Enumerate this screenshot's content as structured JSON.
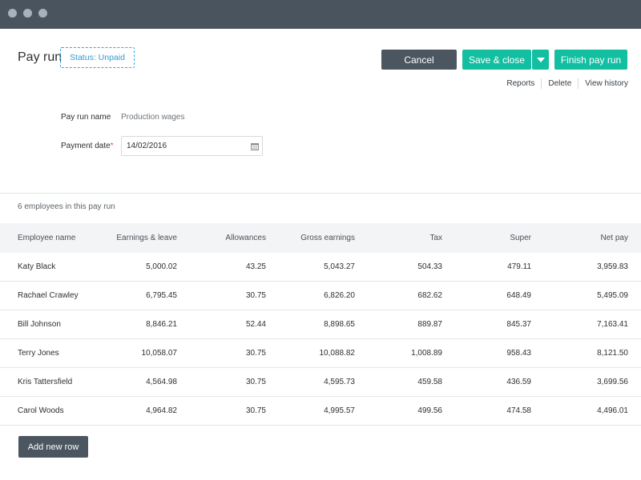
{
  "window": {
    "controls": [
      "close",
      "minimize",
      "maximize"
    ]
  },
  "header": {
    "title": "Pay run",
    "status": "Status: Unpaid",
    "buttons": {
      "cancel": "Cancel",
      "save_close": "Save & close",
      "finish": "Finish pay run"
    },
    "links": [
      "Reports",
      "Delete",
      "View history"
    ]
  },
  "form": {
    "pay_run_name_label": "Pay run name",
    "pay_run_name_value": "Production wages",
    "payment_date_label": "Payment date",
    "payment_date_required": "*",
    "payment_date_value": "14/02/2016"
  },
  "employees_summary": "6 employees in this pay run",
  "table": {
    "columns": [
      "Employee name",
      "Earnings & leave",
      "Allowances",
      "Gross earnings",
      "Tax",
      "Super",
      "Net pay"
    ],
    "rows": [
      [
        "Katy Black",
        "5,000.02",
        "43.25",
        "5,043.27",
        "504.33",
        "479.11",
        "3,959.83"
      ],
      [
        "Rachael Crawley",
        "6,795.45",
        "30.75",
        "6,826.20",
        "682.62",
        "648.49",
        "5,495.09"
      ],
      [
        "Bill Johnson",
        "8,846.21",
        "52.44",
        "8,898.65",
        "889.87",
        "845.37",
        "7,163.41"
      ],
      [
        "Terry Jones",
        "10,058.07",
        "30.75",
        "10,088.82",
        "1,008.89",
        "958.43",
        "8,121.50"
      ],
      [
        "Kris Tattersfield",
        "4,564.98",
        "30.75",
        "4,595.73",
        "459.58",
        "436.59",
        "3,699.56"
      ],
      [
        "Carol Woods",
        "4,964.82",
        "30.75",
        "4,995.57",
        "499.56",
        "474.58",
        "4,496.01"
      ]
    ]
  },
  "add_row_label": "Add new row",
  "colors": {
    "accent": "#13bfa1",
    "dark_button": "#4c5660",
    "titlebar": "#4a545f",
    "status": "#2f9bd0"
  }
}
